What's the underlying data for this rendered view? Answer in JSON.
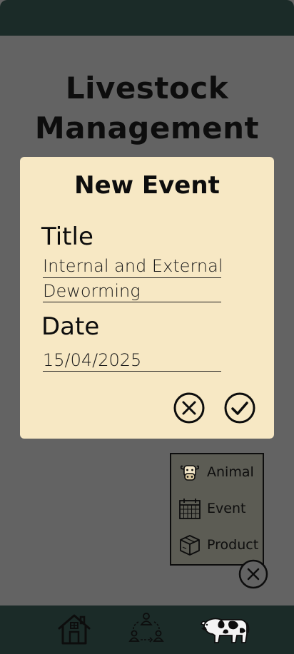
{
  "app": {
    "title_line1": "Livestock",
    "title_line2": "Management"
  },
  "modal": {
    "title": "New Event",
    "title_label": "Title",
    "title_value_line1": "Internal and External",
    "title_value_line2": "Deworming",
    "date_label": "Date",
    "date_value": "15/04/2025",
    "cancel_icon": "close-circle-icon",
    "confirm_icon": "check-circle-icon"
  },
  "add_menu": {
    "items": [
      {
        "label": "Animal",
        "icon": "cow-face-icon"
      },
      {
        "label": "Event",
        "icon": "calendar-icon"
      },
      {
        "label": "Product",
        "icon": "box-icon"
      }
    ],
    "close_icon": "close-circle-icon"
  },
  "bottom_nav": {
    "items": [
      {
        "icon": "home-icon"
      },
      {
        "icon": "people-network-icon"
      },
      {
        "icon": "cow-icon"
      }
    ]
  },
  "colors": {
    "background": "#636363",
    "bars": "#1b2b28",
    "modal": "#f7e8c4"
  }
}
